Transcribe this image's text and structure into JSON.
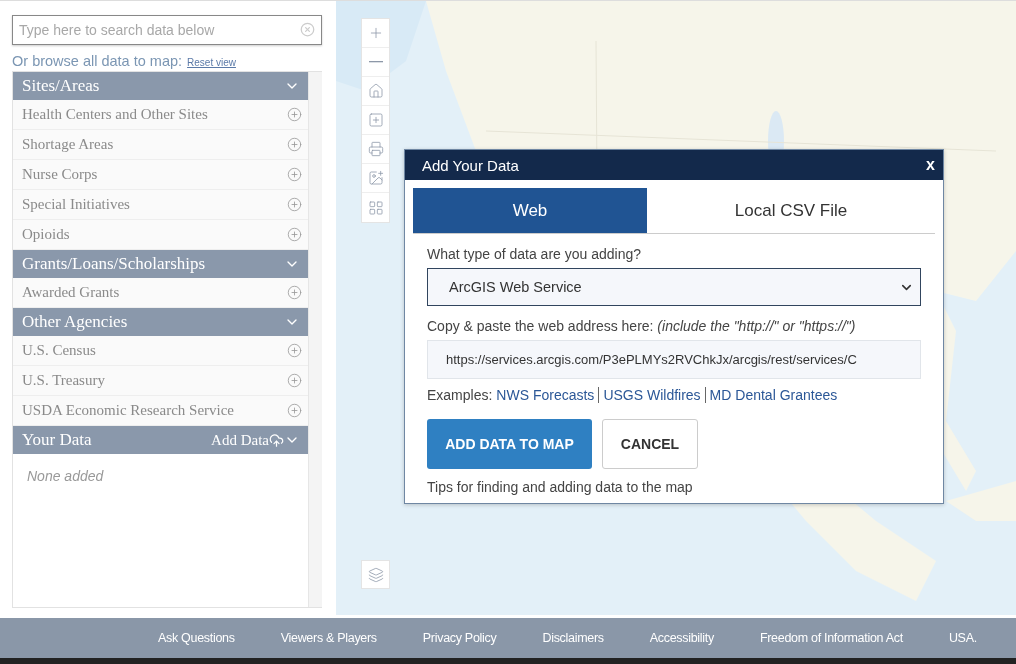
{
  "search": {
    "placeholder": "Type here to search data below"
  },
  "browse": {
    "label": "Or browse all data to map:",
    "reset_link": "Reset view"
  },
  "sections": [
    {
      "title": "Sites/Areas",
      "expanded": true,
      "items": [
        "Health Centers and Other Sites",
        "Shortage Areas",
        "Nurse Corps",
        "Special Initiatives",
        "Opioids"
      ]
    },
    {
      "title": "Grants/Loans/Scholarships",
      "expanded": true,
      "items": [
        "Awarded Grants"
      ]
    },
    {
      "title": "Other Agencies",
      "expanded": true,
      "items": [
        "U.S. Census",
        "U.S. Treasury",
        "USDA Economic Research Service"
      ]
    },
    {
      "title": "Your Data",
      "expanded": true,
      "action": "Add Data",
      "empty_text": "None added"
    }
  ],
  "dialog": {
    "title": "Add Your Data",
    "close": "x",
    "tabs": [
      {
        "label": "Web",
        "selected": true
      },
      {
        "label": "Local CSV File",
        "selected": false
      }
    ],
    "type_label": "What type of data are you adding?",
    "type_value": "ArcGIS Web Service",
    "url_label": "Copy & paste the web address here: *(include the \"http://\" or \"https://\")*",
    "url_value": "https://services.arcgis.com/P3ePLMYs2RVChkJx/arcgis/rest/services/C",
    "examples_label": "Examples:",
    "examples": [
      "NWS Forecasts",
      "USGS Wildfires",
      "MD Dental Grantees"
    ],
    "primary": "ADD DATA TO MAP",
    "secondary": "CANCEL",
    "tips": "Tips for finding and adding data to the map"
  },
  "footer": [
    "Ask Questions",
    "Viewers & Players",
    "Privacy Policy",
    "Disclaimers",
    "Accessibility",
    "Freedom of Information Act",
    "USA."
  ]
}
